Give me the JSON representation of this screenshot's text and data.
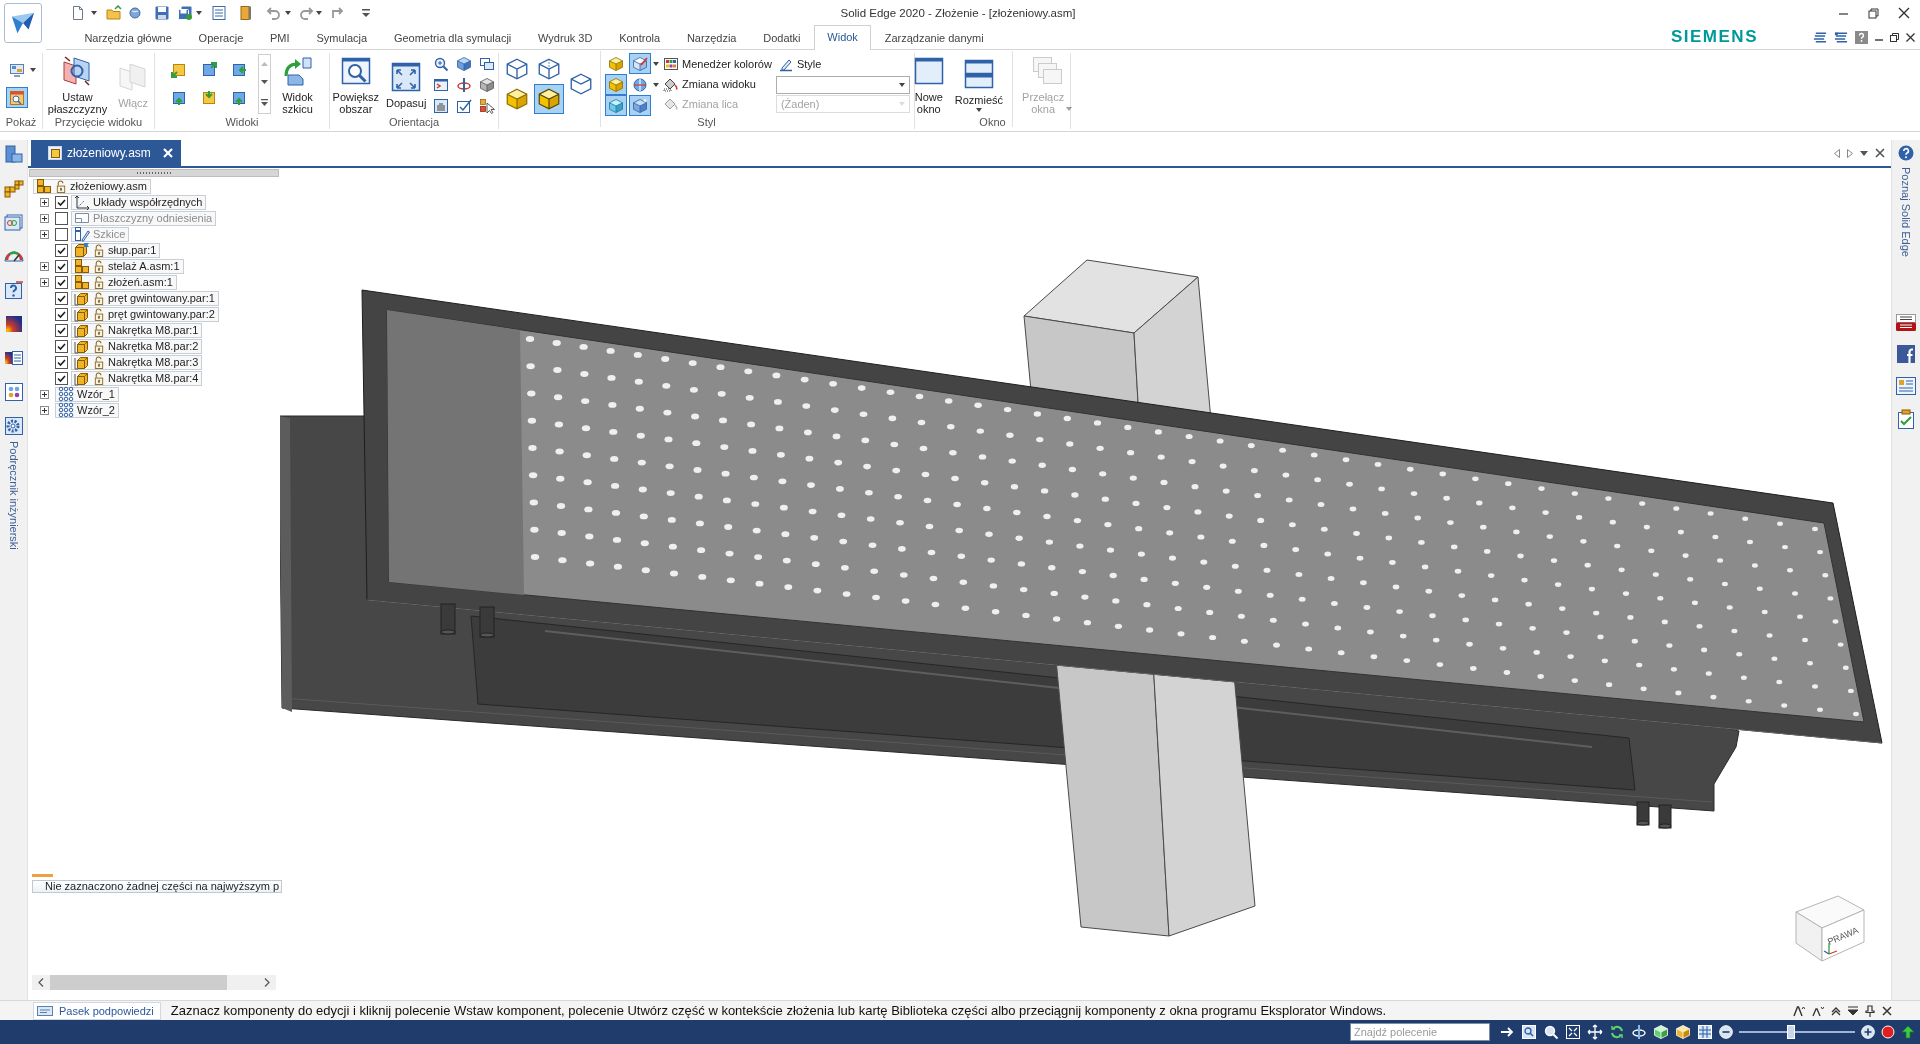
{
  "window": {
    "title": "Solid Edge 2020 - Złożenie - [złożeniowy.asm]"
  },
  "ribbon_tabs": [
    {
      "label": "Narzędzia główne",
      "selected": false
    },
    {
      "label": "Operacje",
      "selected": false
    },
    {
      "label": "PMI",
      "selected": false
    },
    {
      "label": "Symulacja",
      "selected": false
    },
    {
      "label": "Geometria dla symulacji",
      "selected": false
    },
    {
      "label": "Wydruk 3D",
      "selected": false
    },
    {
      "label": "Kontrola",
      "selected": false
    },
    {
      "label": "Narzędzia",
      "selected": false
    },
    {
      "label": "Dodatki",
      "selected": false
    },
    {
      "label": "Widok",
      "selected": true
    },
    {
      "label": "Zarządzanie danymi",
      "selected": false
    }
  ],
  "brand": {
    "name": "SIEMENS"
  },
  "ribbon": {
    "groups": [
      {
        "label": "Pokaż",
        "items": [
          {
            "kind": "small",
            "on": false,
            "menu": true
          },
          {
            "kind": "small",
            "on": true,
            "menu": false
          }
        ]
      },
      {
        "label": "Przycięcie widoku",
        "items": [
          {
            "kind": "large",
            "label": "Ustaw płaszczyzny",
            "disabled": false,
            "menu": false
          },
          {
            "kind": "large",
            "label": "Włącz",
            "disabled": true,
            "menu": false
          }
        ]
      },
      {
        "label": "Widoki",
        "items": [
          {
            "kind": "small",
            "on": false,
            "menu": false
          },
          {
            "kind": "small",
            "on": false,
            "menu": false
          },
          {
            "kind": "small",
            "on": false,
            "menu": false
          },
          {
            "kind": "small",
            "on": false,
            "menu": false
          },
          {
            "kind": "small",
            "on": false,
            "menu": false
          },
          {
            "kind": "small",
            "on": false,
            "menu": false
          },
          {
            "kind": "gallery-scroll"
          },
          {
            "kind": "large",
            "label": "Widok szkicu",
            "disabled": false,
            "menu": false
          }
        ]
      },
      {
        "label": "Orientacja",
        "items": [
          {
            "kind": "large",
            "label": "Powiększ obszar",
            "disabled": false,
            "menu": false
          },
          {
            "kind": "large",
            "label": "Dopasuj",
            "disabled": false,
            "menu": false
          },
          {
            "kind": "small",
            "on": false,
            "menu": false
          },
          {
            "kind": "small",
            "on": false,
            "menu": false
          },
          {
            "kind": "small",
            "on": false,
            "menu": false
          },
          {
            "kind": "small",
            "on": false,
            "menu": false
          },
          {
            "kind": "small",
            "on": false,
            "menu": false
          },
          {
            "kind": "small",
            "on": false,
            "menu": false
          },
          {
            "kind": "small",
            "on": false,
            "menu": false
          },
          {
            "kind": "small",
            "on": false,
            "menu": false
          },
          {
            "kind": "small",
            "on": false,
            "menu": false
          }
        ]
      },
      {
        "label": "Styl",
        "items": [
          {
            "kind": "small",
            "on": false,
            "menu": false
          },
          {
            "kind": "small",
            "on": false,
            "menu": false
          },
          {
            "kind": "small",
            "on": false,
            "menu": false
          },
          {
            "kind": "small",
            "on": true,
            "menu": false
          },
          {
            "kind": "small",
            "on": false,
            "menu": false
          },
          {
            "kind": "small",
            "on": false,
            "menu": false
          },
          {
            "kind": "small",
            "on": true,
            "menu": false
          },
          {
            "kind": "small",
            "on": true,
            "menu": false
          },
          {
            "kind": "small",
            "on": true,
            "menu": true
          },
          {
            "kind": "small",
            "on": false,
            "menu": true
          },
          {
            "kind": "small",
            "on": true,
            "menu": false
          },
          {
            "kind": "row",
            "label": "Menedżer kolorów",
            "disabled": false
          },
          {
            "kind": "row",
            "label": "Zmiana widoku",
            "disabled": false
          },
          {
            "kind": "row",
            "label": "Zmiana lica",
            "disabled": true
          },
          {
            "kind": "row",
            "label": "Style",
            "disabled": false
          },
          {
            "kind": "dropdown",
            "disabled": false
          },
          {
            "kind": "dropdown",
            "value": "(Żaden)",
            "disabled": true
          }
        ]
      },
      {
        "label": "Okno",
        "items": [
          {
            "kind": "large",
            "label": "Nowe okno",
            "disabled": false,
            "menu": false
          },
          {
            "kind": "large",
            "label": "Rozmieść",
            "disabled": false,
            "menu": true
          },
          {
            "kind": "large",
            "label": "Przełącz okna",
            "disabled": true,
            "menu": true
          }
        ]
      }
    ]
  },
  "document_tabs": [
    {
      "label": "złożeniowy.asm",
      "selected": true
    }
  ],
  "pathfinder": {
    "tree": {
      "label": "złożeniowy.asm",
      "kind": "assembly",
      "children": [
        {
          "label": "Układy współrzędnych",
          "kind": "coordinate-systems",
          "checked": true,
          "expandable": true
        },
        {
          "label": "Płaszczyzny odniesienia",
          "kind": "reference-planes",
          "checked": false,
          "expandable": true
        },
        {
          "label": "Szkice",
          "kind": "sketches",
          "checked": false,
          "expandable": true
        },
        {
          "label": "słup.par:1",
          "kind": "part",
          "checked": true,
          "expandable": false
        },
        {
          "label": "stelaż A.asm:1",
          "kind": "assembly",
          "checked": true,
          "expandable": true
        },
        {
          "label": "złożeń.asm:1",
          "kind": "assembly",
          "checked": true,
          "expandable": true
        },
        {
          "label": "pręt gwintowany.par:1",
          "kind": "standard-part",
          "checked": true,
          "expandable": false
        },
        {
          "label": "pręt gwintowany.par:2",
          "kind": "standard-part",
          "checked": true,
          "expandable": false
        },
        {
          "label": "Nakrętka M8.par:1",
          "kind": "standard-part",
          "checked": true,
          "expandable": false
        },
        {
          "label": "Nakrętka M8.par:2",
          "kind": "standard-part",
          "checked": true,
          "expandable": false
        },
        {
          "label": "Nakrętka M8.par:3",
          "kind": "standard-part",
          "checked": true,
          "expandable": false
        },
        {
          "label": "Nakrętka M8.par:4",
          "kind": "standard-part",
          "checked": true,
          "expandable": false
        },
        {
          "label": "Wzór_1",
          "kind": "pattern",
          "expandable": true
        },
        {
          "label": "Wzór_2",
          "kind": "pattern",
          "expandable": true
        }
      ]
    },
    "note": "Nie zaznaczono żadnej części na najwyższym p"
  },
  "side_panels": {
    "left": {
      "label": "Podręcznik inżynierski"
    },
    "right": {
      "label": "Poznaj Solid Edge"
    }
  },
  "view_cube": {
    "face_label": "PRAWA"
  },
  "prompt_bar": {
    "tab_label": "Pasek podpowiedzi",
    "text": "Zaznacz komponenty do edycji i kliknij polecenie Wstaw komponent, polecenie Utwórz część w kontekście złożenia lub kartę Biblioteka części albo przeciągnij komponenty z okna programu Eksplorator Windows."
  },
  "status_bar": {
    "search": {
      "placeholder": "Znajdź polecenie"
    },
    "zoom_slider": {
      "level": 0.45
    }
  }
}
